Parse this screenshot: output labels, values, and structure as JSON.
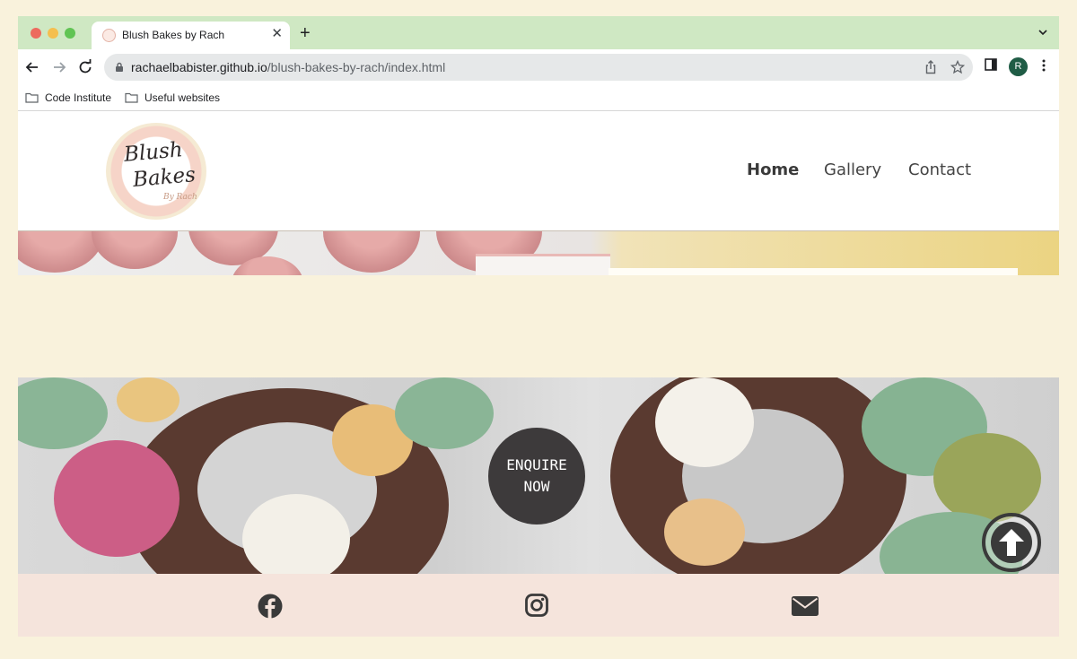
{
  "browser": {
    "tab": {
      "title": "Blush Bakes by Rach"
    },
    "url": {
      "host": "rachaelbabister.github.io",
      "path": "/blush-bakes-by-rach/index.html"
    },
    "profile_initial": "R",
    "bookmarks": [
      {
        "label": "Code Institute"
      },
      {
        "label": "Useful websites"
      }
    ]
  },
  "site": {
    "logo": {
      "line1": "Blush",
      "line2": "Bakes",
      "line3": "By Rach"
    },
    "nav": [
      {
        "label": "Home",
        "active": true
      },
      {
        "label": "Gallery"
      },
      {
        "label": "Contact"
      }
    ],
    "cta": {
      "label": "ENQUIRE\nNOW"
    },
    "footer": {
      "icons": [
        "facebook-icon",
        "instagram-icon",
        "envelope-icon"
      ]
    }
  },
  "colors": {
    "page_background": "#f9f2dc",
    "tab_strip": "#cfe8c3",
    "button_dark": "#3d3a3b",
    "footer_background": "#f5e4dc",
    "profile": "#1f5c45"
  }
}
